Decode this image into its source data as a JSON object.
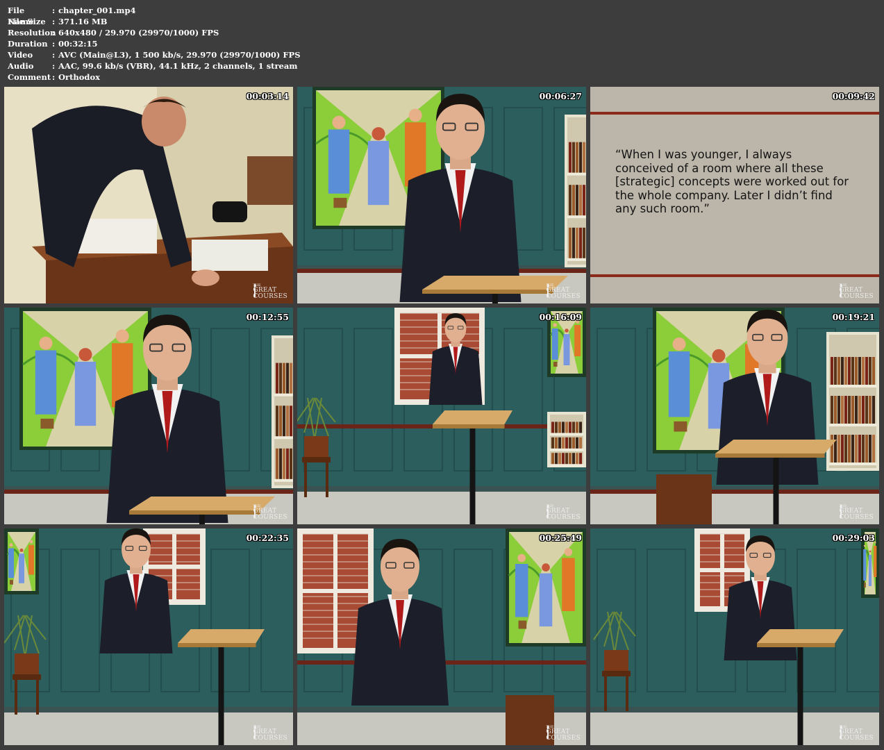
{
  "info": [
    {
      "key": "File Name",
      "value": "chapter_001.mp4"
    },
    {
      "key": "File Size",
      "value": "371.16 MB"
    },
    {
      "key": "Resolution",
      "value": "640x480 / 29.970 (29970/1000) FPS"
    },
    {
      "key": "Duration",
      "value": "00:32:15"
    },
    {
      "key": "Video",
      "value": "AVC (Main@L3), 1 500 kb/s, 29.970 (29970/1000) FPS"
    },
    {
      "key": "Audio",
      "value": "AAC, 99.6 kb/s (VBR), 44.1 kHz, 2 channels, 1 stream"
    },
    {
      "key": "Comment",
      "value": "Orthodox"
    }
  ],
  "separator": ":",
  "logo": {
    "small": "THE",
    "line1": "GREAT",
    "line2": "COURSES"
  },
  "thumbnails": [
    {
      "timestamp": "00:03:14",
      "scene": "archive"
    },
    {
      "timestamp": "00:06:27",
      "scene": "speaker-podium"
    },
    {
      "timestamp": "00:09:42",
      "scene": "quote",
      "quote": "“When I was younger, I always conceived of a room where all these [strategic] concepts were worked out for the whole company. Later I didn’t find any such room.”"
    },
    {
      "timestamp": "00:12:55",
      "scene": "speaker-podium"
    },
    {
      "timestamp": "00:16:09",
      "scene": "speaker-wide"
    },
    {
      "timestamp": "00:19:21",
      "scene": "speaker-gesture"
    },
    {
      "timestamp": "00:22:35",
      "scene": "speaker-standing"
    },
    {
      "timestamp": "00:25:49",
      "scene": "speaker-standing"
    },
    {
      "timestamp": "00:29:03",
      "scene": "speaker-standing"
    }
  ],
  "colors": {
    "background": "#3d3d3d",
    "wall": "#2c5e5e",
    "quote_bg": "#bcb6aa",
    "rule": "#8b2a1a"
  }
}
